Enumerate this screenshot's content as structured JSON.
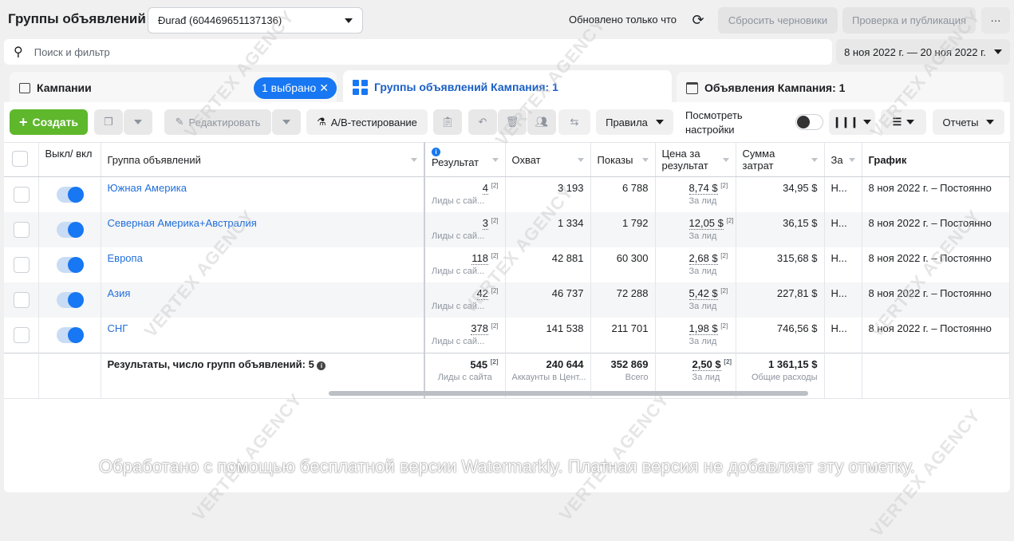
{
  "header": {
    "title": "Группы объявлений",
    "account": "Đurađ (604469651137136)",
    "updated": "Обновлено только что",
    "reset": "Сбросить черновики",
    "publish": "Проверка и публикация",
    "more": "···"
  },
  "search": {
    "placeholder": "Поиск и фильтр"
  },
  "date_range": "8 ноя 2022 г. — 20 ноя 2022 г.",
  "tabs": {
    "campaigns": "Кампании",
    "selected": "1 выбрано",
    "adsets": "Группы объявлений Кампания: 1",
    "ads": "Объявления Кампания: 1"
  },
  "toolbar": {
    "create": "Создать",
    "edit": "Редактировать",
    "ab": "A/B-тестирование",
    "rules": "Правила",
    "view_settings_1": "Посмотреть",
    "view_settings_2": "настройки",
    "reports": "Отчеты"
  },
  "columns": {
    "toggle": "Выкл/ вкл",
    "name": "Группа объявлений",
    "result": "Результат",
    "reach": "Охват",
    "impressions": "Показы",
    "cost": "Цена за результат",
    "spend": "Сумма затрат",
    "za": "За",
    "schedule": "График"
  },
  "rows": [
    {
      "name": "Южная Америка",
      "result": "4",
      "result_sub": "Лиды с сай...",
      "reach": "3 193",
      "impressions": "6 788",
      "cost": "8,74 $",
      "cost_sub": "За лид",
      "spend": "34,95 $",
      "za": "Н...",
      "schedule": "8 ноя 2022 г. – Постоянно"
    },
    {
      "name": "Северная Америка+Австралия",
      "result": "3",
      "result_sub": "Лиды с сай...",
      "reach": "1 334",
      "impressions": "1 792",
      "cost": "12,05 $",
      "cost_sub": "За лид",
      "spend": "36,15 $",
      "za": "Н...",
      "schedule": "8 ноя 2022 г. – Постоянно"
    },
    {
      "name": "Европа",
      "result": "118",
      "result_sub": "Лиды с сай...",
      "reach": "42 881",
      "impressions": "60 300",
      "cost": "2,68 $",
      "cost_sub": "За лид",
      "spend": "315,68 $",
      "za": "Н...",
      "schedule": "8 ноя 2022 г. – Постоянно"
    },
    {
      "name": "Азия",
      "result": "42",
      "result_sub": "Лиды с сай...",
      "reach": "46 737",
      "impressions": "72 288",
      "cost": "5,42 $",
      "cost_sub": "За лид",
      "spend": "227,81 $",
      "za": "Н...",
      "schedule": "8 ноя 2022 г. – Постоянно"
    },
    {
      "name": "СНГ",
      "result": "378",
      "result_sub": "Лиды с сай...",
      "reach": "141 538",
      "impressions": "211 701",
      "cost": "1,98 $",
      "cost_sub": "За лид",
      "spend": "746,56 $",
      "za": "Н...",
      "schedule": "8 ноя 2022 г. – Постоянно"
    }
  ],
  "footnote": "[2]",
  "totals": {
    "label": "Результаты, число групп объявлений: 5",
    "result": "545",
    "result_sub": "Лиды с сайта",
    "reach": "240 644",
    "reach_sub": "Аккаунты в Цент...",
    "impressions": "352 869",
    "impressions_sub": "Всего",
    "cost": "2,50 $",
    "cost_sub": "За лид",
    "spend": "1 361,15 $",
    "spend_sub": "Общие расходы"
  },
  "watermark": "VERTEX AGENCY",
  "caption": "Обработано с помощью бесплатной версии Watermarkly. Платная версия не добавляет эту отметку."
}
